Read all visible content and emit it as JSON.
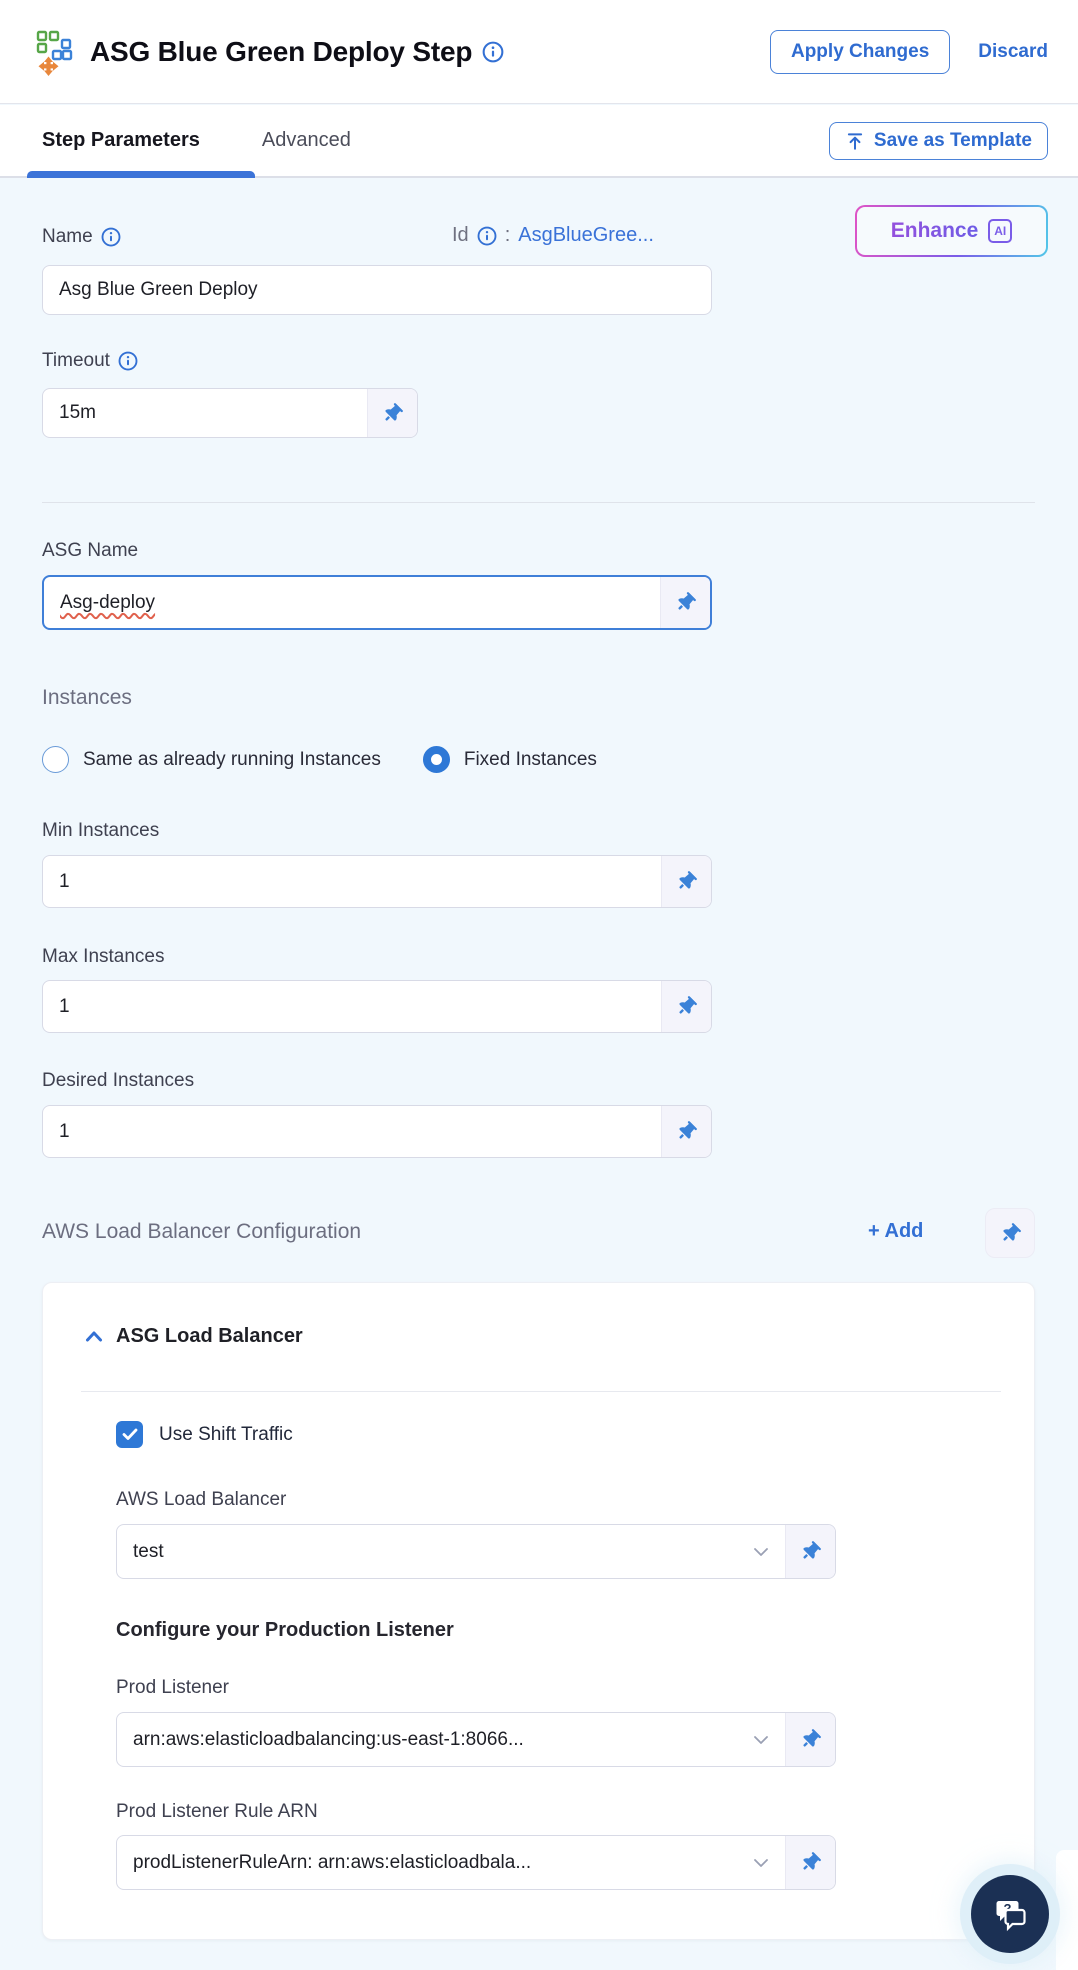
{
  "header": {
    "title": "ASG Blue Green Deploy Step",
    "apply_button": "Apply Changes",
    "discard_button": "Discard"
  },
  "tabs": {
    "step_parameters": "Step Parameters",
    "advanced": "Advanced",
    "save_as_template": "Save as Template"
  },
  "form": {
    "name_label": "Name",
    "id_label": "Id",
    "id_separator": ":",
    "id_value": "AsgBlueGree...",
    "enhance_button": "Enhance",
    "enhance_badge": "AI",
    "name_value": "Asg Blue Green Deploy",
    "timeout_label": "Timeout",
    "timeout_value": "15m",
    "asg_name_label": "ASG Name",
    "asg_name_value": "Asg-deploy",
    "instances_heading": "Instances",
    "radio_same_label": "Same as already running Instances",
    "radio_fixed_label": "Fixed Instances",
    "min_label": "Min Instances",
    "min_value": "1",
    "max_label": "Max Instances",
    "max_value": "1",
    "desired_label": "Desired Instances",
    "desired_value": "1"
  },
  "load_balancer": {
    "heading": "AWS Load Balancer Configuration",
    "add_button": "+ Add",
    "card_title": "ASG Load Balancer",
    "use_shift_traffic_label": "Use Shift Traffic",
    "aws_lb_label": "AWS Load Balancer",
    "aws_lb_value": "test",
    "configure_heading": "Configure your Production Listener",
    "prod_listener_label": "Prod Listener",
    "prod_listener_value": "arn:aws:elasticloadbalancing:us-east-1:8066...",
    "prod_rule_label": "Prod Listener Rule ARN",
    "prod_rule_value": "prodListenerRuleArn: arn:aws:elasticloadbala..."
  },
  "colors": {
    "primary_blue": "#3370d4",
    "pin_blue": "#3b82d8",
    "tab_underline_blue": "#3b73d8",
    "body_background": "#f1f8fd",
    "checkbox_blue": "#2e78d6",
    "fab_navy": "#1b3054",
    "error_red": "#e0614d",
    "enhance_gradient": [
      "#df54c6",
      "#7a5ce8",
      "#52c7e8"
    ],
    "icon_green": "#57a648",
    "icon_orange": "#e8873c"
  }
}
